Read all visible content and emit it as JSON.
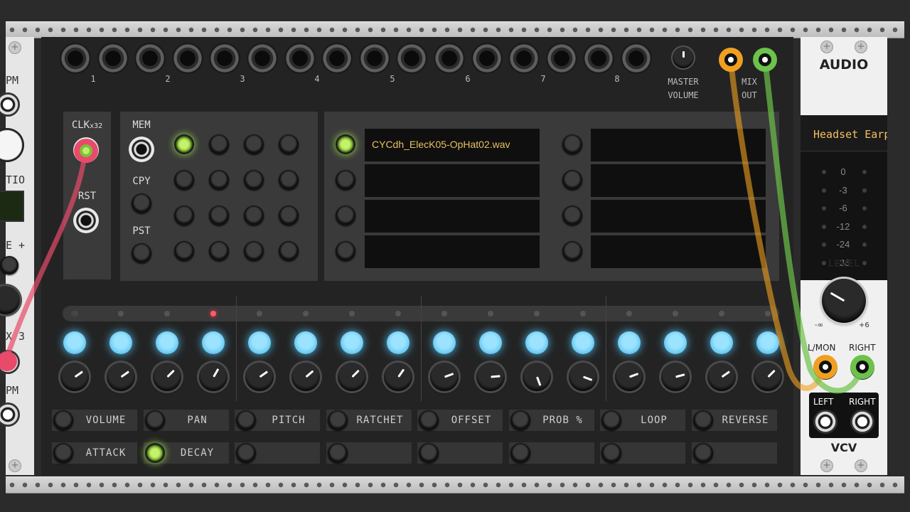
{
  "left_module": {
    "labels": [
      "PM",
      "TIO",
      "E +",
      "X 3",
      "PM"
    ]
  },
  "main": {
    "track_numbers": [
      "1",
      "2",
      "3",
      "4",
      "5",
      "6",
      "7",
      "8"
    ],
    "master_volume_label": [
      "MASTER",
      "VOLUME"
    ],
    "mix_out_label": [
      "MIX",
      "OUT"
    ],
    "clock": {
      "clk_label": "CLK",
      "clk_sub": "x32",
      "rst_label": "RST"
    },
    "memory": {
      "mem_label": "MEM",
      "cpy_label": "CPY",
      "pst_label": "PST"
    },
    "sample_slots": {
      "left": [
        "CYCdh_ElecK05-OpHat02.wav",
        "",
        "",
        ""
      ],
      "right": [
        "",
        "",
        "",
        ""
      ]
    },
    "step_knob_angles_deg": [
      235,
      235,
      225,
      210,
      235,
      230,
      225,
      215,
      250,
      265,
      340,
      290,
      250,
      255,
      235,
      225
    ],
    "params_row1": [
      "VOLUME",
      "PAN",
      "PITCH",
      "RATCHET",
      "OFFSET",
      "PROB %",
      "LOOP",
      "REVERSE"
    ],
    "params_row2": [
      "ATTACK",
      "DECAY",
      "",
      "",
      "",
      "",
      "",
      ""
    ],
    "active_param_row2_index": 1,
    "active_step_led_index": 3
  },
  "audio": {
    "title": "AUDIO",
    "device": "Headset Earp",
    "vu_levels": [
      "0",
      "-3",
      "-6",
      "-12",
      "-24",
      "-36"
    ],
    "level_label": "LEVEL",
    "level_min": "-∞",
    "level_max": "+6",
    "input_labels": [
      "L/MON",
      "RIGHT"
    ],
    "output_labels": [
      "LEFT",
      "RIGHT"
    ],
    "brand": "VCV"
  },
  "colors": {
    "cable_red": "#e84a6a",
    "cable_orange": "#f0a020",
    "cable_green": "#6cc24a",
    "slot_text": "#e8c060",
    "step_button": "#7fd4f8"
  }
}
